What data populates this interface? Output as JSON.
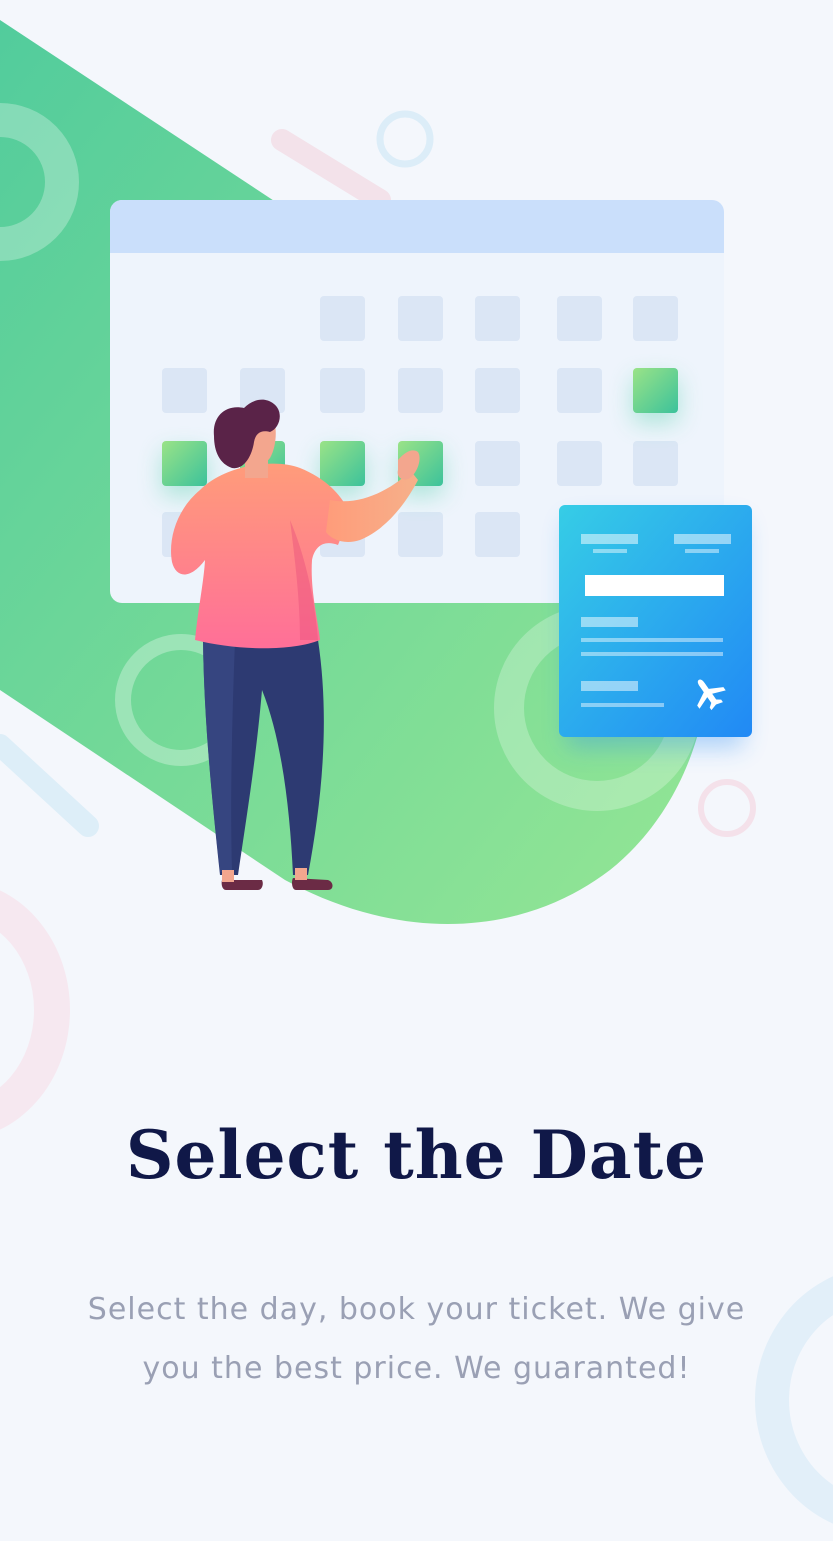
{
  "onboarding": {
    "title": "Select the Date",
    "description": "Select the day, book your ticket. We give you the best price. We guaranted!"
  },
  "illustration": {
    "icon": "airplane-icon",
    "colors": {
      "background": "#f4f7fc",
      "green_shape": "#5fd39a",
      "calendar_header": "#cadffb",
      "calendar_body": "#eef4fc",
      "selected_day": "#5fd39a",
      "ticket": "#2a9cf0",
      "title": "#101848",
      "description": "#9aa0b4"
    },
    "selected_days": [
      "row 2, column 7",
      "row 3, column 1",
      "row 3, column 2",
      "row 3, column 3",
      "row 3, column 4"
    ]
  }
}
